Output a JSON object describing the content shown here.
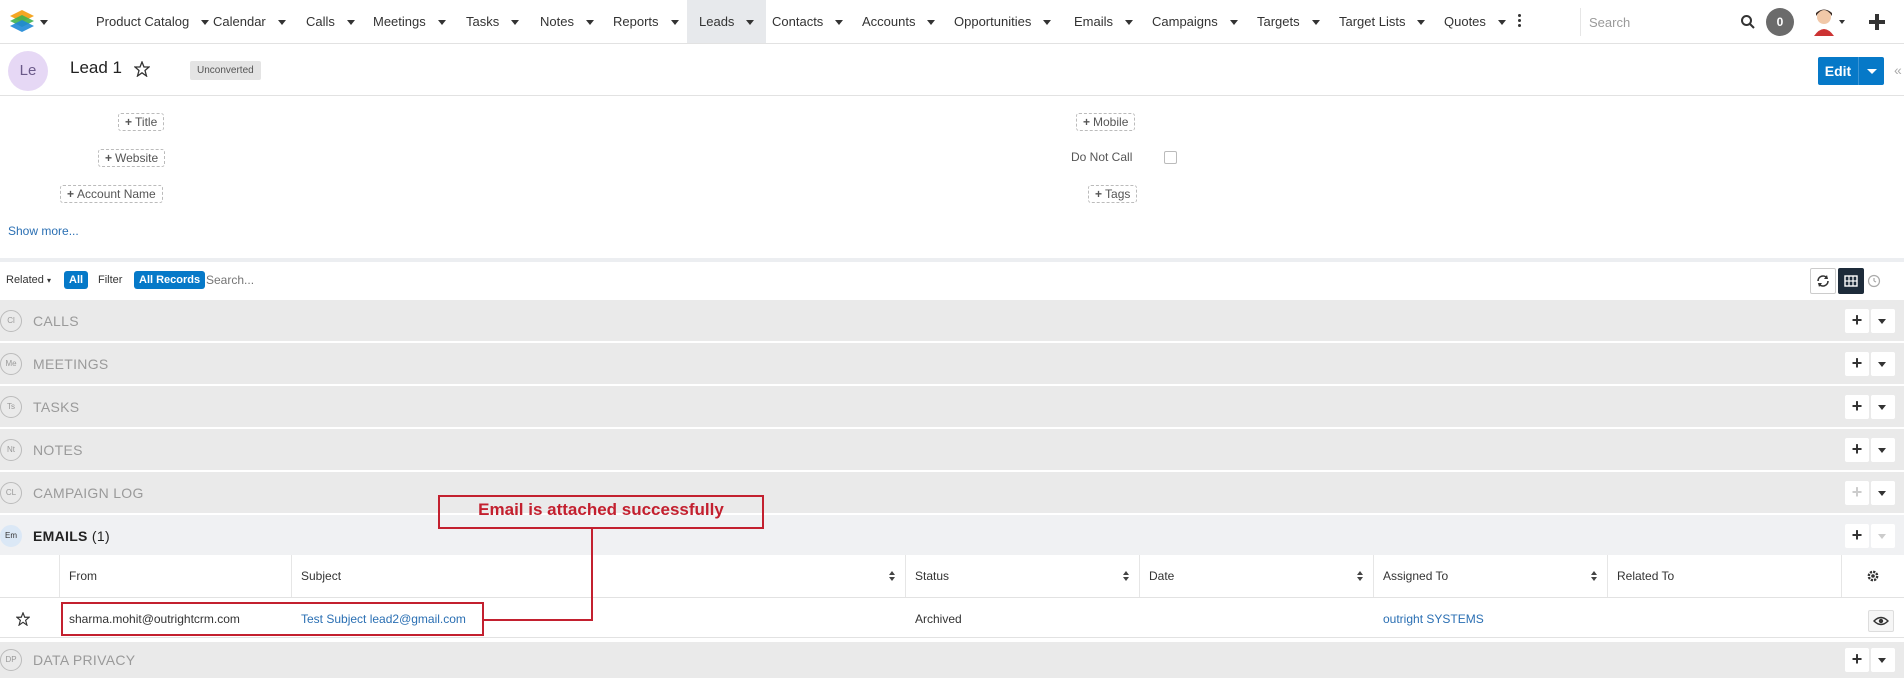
{
  "nav": {
    "items": [
      {
        "label": "Product Catalog"
      },
      {
        "label": "Calendar"
      },
      {
        "label": "Calls"
      },
      {
        "label": "Meetings"
      },
      {
        "label": "Tasks"
      },
      {
        "label": "Notes"
      },
      {
        "label": "Reports"
      },
      {
        "label": "Leads",
        "active": true
      },
      {
        "label": "Contacts"
      },
      {
        "label": "Accounts"
      },
      {
        "label": "Opportunities"
      },
      {
        "label": "Emails"
      },
      {
        "label": "Campaigns"
      },
      {
        "label": "Targets"
      },
      {
        "label": "Target Lists"
      },
      {
        "label": "Quotes"
      }
    ],
    "search_placeholder": "Search",
    "notification_count": "0"
  },
  "record": {
    "avatar_initials": "Le",
    "title": "Lead 1",
    "status_badge": "Unconverted",
    "edit_label": "Edit"
  },
  "fields": {
    "title_add": "Title",
    "website_add": "Website",
    "account_name_add": "Account Name",
    "mobile_add": "Mobile",
    "do_not_call_label": "Do Not Call",
    "tags_add": "Tags",
    "show_more": "Show more..."
  },
  "related_bar": {
    "related_label": "Related",
    "all_badge": "All",
    "filter_label": "Filter",
    "all_records_badge": "All Records",
    "search_placeholder": "Search..."
  },
  "sections": [
    {
      "icon": "Cl",
      "title": "CALLS"
    },
    {
      "icon": "Me",
      "title": "MEETINGS"
    },
    {
      "icon": "Ts",
      "title": "TASKS"
    },
    {
      "icon": "Nt",
      "title": "NOTES"
    },
    {
      "icon": "CL",
      "title": "CAMPAIGN LOG"
    },
    {
      "icon": "Em",
      "title": "EMAILS",
      "count": "(1)"
    },
    {
      "icon": "DP",
      "title": "DATA PRIVACY"
    }
  ],
  "emails_table": {
    "columns": [
      "From",
      "Subject",
      "Status",
      "Date",
      "Assigned To",
      "Related To"
    ],
    "rows": [
      {
        "from": "sharma.mohit@outrightcrm.com",
        "subject": "Test Subject lead2@gmail.com",
        "status": "Archived",
        "date": "",
        "assigned_to": "outright SYSTEMS",
        "related_to": ""
      }
    ]
  },
  "annotation": {
    "text": "Email is attached successfully",
    "color": "#c3202f"
  },
  "colors": {
    "primary": "#0679c8",
    "link": "#2a6fb3",
    "section_bg": "#eaeaea"
  }
}
